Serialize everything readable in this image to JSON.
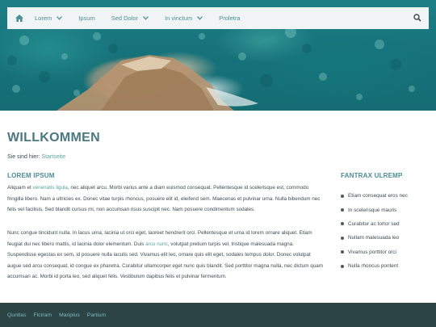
{
  "nav": {
    "home_icon": "home-icon",
    "items": [
      {
        "label": "Lorem",
        "dropdown": true
      },
      {
        "label": "Ipsum",
        "dropdown": false
      },
      {
        "label": "Sed Dolor",
        "dropdown": true
      },
      {
        "label": "In vinctum",
        "dropdown": true
      },
      {
        "label": "Proletra",
        "dropdown": false
      }
    ],
    "search_icon": "search-icon"
  },
  "page": {
    "title": "WILLKOMMEN",
    "breadcrumb_prefix": "Sie sind hier:",
    "breadcrumb_link": "Startseite"
  },
  "main": {
    "heading": "LOREM IPSUM",
    "p1": {
      "a": "Aliquam et ",
      "link": "venenatis ligula",
      "b": ", nec aliquet arcu. Morbi varius ante a diam euismod consequat. Pellentesque id scelerisque est, commodo fringilla libero. Nam a ultricies ex. Donec vitae turpis rhoncus, posuere elit id, eleifend sem. Maecenas et pulvinar urna. Nulla bibendum nec felis vel facilisis. Sed blandit cursus mi, non accumsan risus suscipit nec. Nam posuere condimentum sodales."
    },
    "p2": {
      "a": "Nunc congue tincidunt nulla. In lacus urna, lacinia ut orci eget, laoreet hendrerit orci. Pellentesque et urna id lorem ornare aliquet. Etiam feugiat dui nec libero mattis, id lacinia dolor elementum. Duis ",
      "link": "arcu nunc",
      "b": ", volutpat pretium turpis vel, tristique malesuada magna. Suspendisse egestas ex sem, id posuere nulla iaculis sed. Vivamus elit leo, ornare quis elit eget, sodales tempus dolor. Donec volutpat augue sed arcu consequat, id congue ex pharetra. Curabitur ullamcorper eget nunc quis blandit. Sed porttitor magna nulla, nec dictum quam accumsan ac. Morbi id porta leo, sed aliquet felis. Vestibulum dapibus felis et pulvinar fermentum."
    }
  },
  "sidebar": {
    "heading": "FANTRAX ULREMP",
    "items": [
      "Etiam consequat eros nec",
      "In scelerisque mauris",
      "Curabitur ac tortor sed",
      "Nullam malesuada leo",
      "Vivamus porttitor orci",
      "Nulla rhoncus pontent"
    ]
  },
  "footer": {
    "links": [
      "Quntlas",
      "Flctram",
      "Mariplus",
      "Partium"
    ]
  },
  "colors": {
    "accent": "#4b8d94",
    "link": "#59a39a",
    "footer_bg": "#2d4447",
    "nav_bg": "#f1f4f5"
  }
}
